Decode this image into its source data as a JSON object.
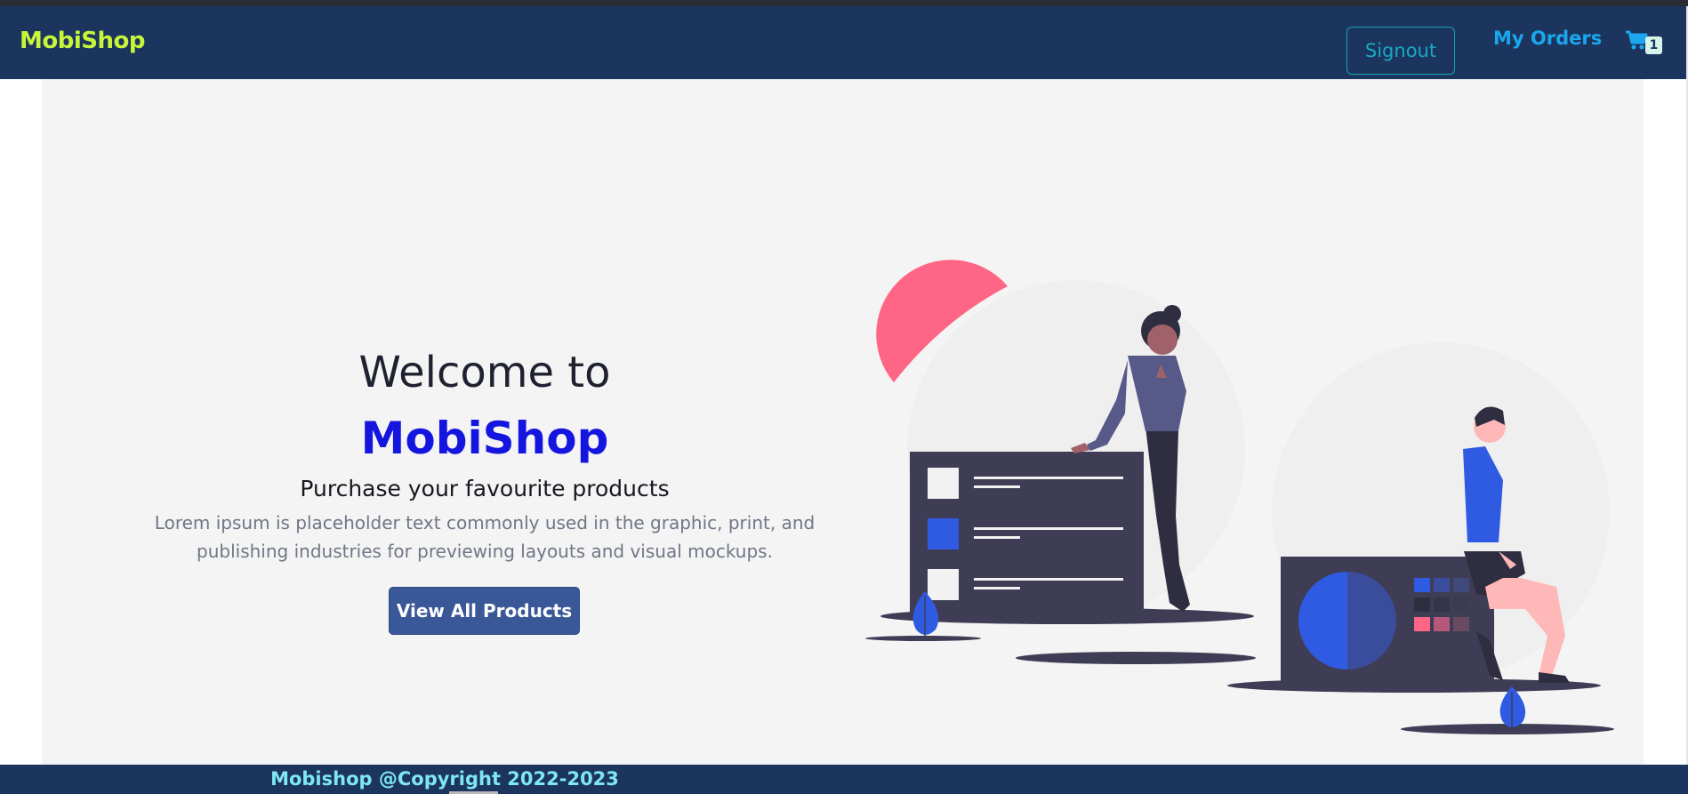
{
  "navbar": {
    "brand": "MobiShop",
    "signout_label": "Signout",
    "orders_label": "My Orders",
    "cart_icon": "shopping-cart-icon",
    "cart_count": "1"
  },
  "hero": {
    "welcome": "Welcome to",
    "brand": "MobiShop",
    "subtitle": "Purchase your favourite products",
    "description": "Lorem ipsum is placeholder text commonly used in the graphic, print, and publishing industries for previewing layouts and visual mockups.",
    "cta_label": "View All Products"
  },
  "footer": {
    "text": "Mobishop @Copyright 2022-2023"
  },
  "colors": {
    "navbar": "#1c355e",
    "brand": "#c6f53a",
    "accent_blue": "#1515e0",
    "button": "#3a5897",
    "footer_text": "#7ee6f4"
  }
}
